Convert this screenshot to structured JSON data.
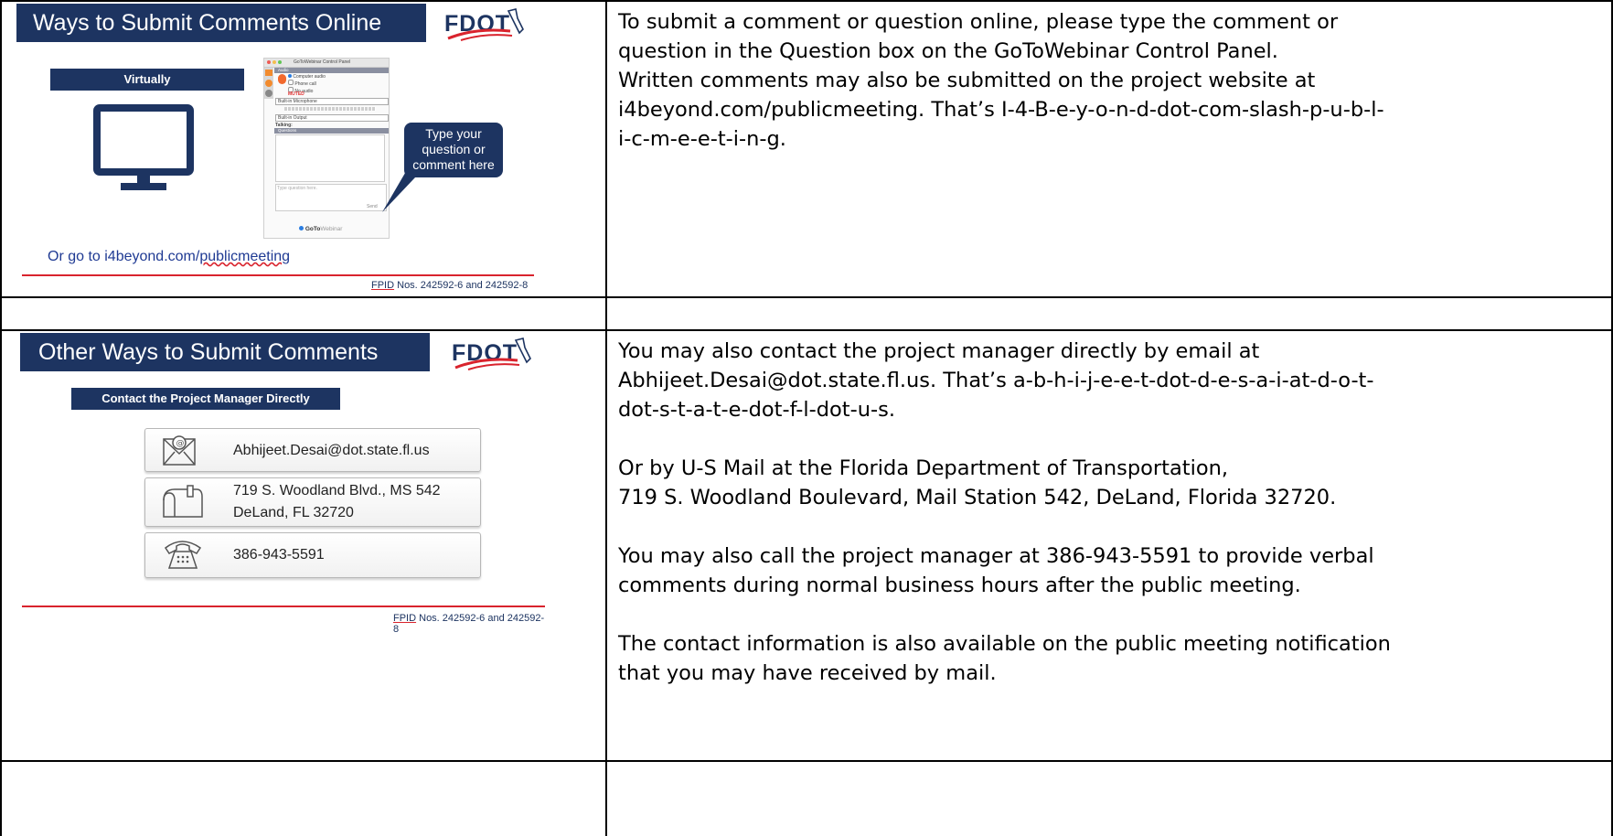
{
  "slide1": {
    "title": "Ways to Submit Comments Online",
    "logo": "FDOT",
    "virtually_label": "Virtually",
    "panel": {
      "title": "GoToWebinar Control Panel",
      "audio_header": "Audio",
      "computer_audio": "Computer audio",
      "phone_call": "Phone call",
      "no_audio": "No audio",
      "muted": "MUTED",
      "microphone": "Built-in Microphone",
      "output": "Built-in Output",
      "talking": "Talking:",
      "questions_header": "Questions",
      "question_placeholder": "Type question here.",
      "send": "Send",
      "brand_bold": "GoTo",
      "brand_light": "Webinar"
    },
    "callout": "Type your question or comment here",
    "link_prefix": "Or go to i4beyond.com/",
    "link_suffix": "publicmeeting",
    "fpid_prefix": "FPID",
    "fpid_rest": " Nos. 242592-6 and 242592-8"
  },
  "slide2": {
    "title": "Other Ways to Submit Comments",
    "logo": "FDOT",
    "contact_label": "Contact the Project Manager Directly",
    "email": "Abhijeet.Desai@dot.state.fl.us",
    "address_line1": "719 S. Woodland Blvd., MS 542",
    "address_line2": "DeLand, FL  32720",
    "phone": "386-943-5591",
    "fpid_prefix": "FPID",
    "fpid_rest": " Nos. 242592-6 and 242592-8"
  },
  "narration1": {
    "line1": "To submit a comment or question online, please type the comment or",
    "line2": "question in the Question box on the GoToWebinar Control Panel.",
    "line3": "Written comments may also be submitted on the project website at",
    "line4": "i4beyond.com/publicmeeting. That’s I-4-B-e-y-o-n-d-dot-com-slash-p-u-b-l-",
    "line5": "i-c-m-e-e-t-i-n-g."
  },
  "narration2": {
    "p1_line1": "You may also contact the project manager directly by email at",
    "p1_line2": "Abhijeet.Desai@dot.state.fl.us. That’s a-b-h-i-j-e-e-t-dot-d-e-s-a-i-at-d-o-t-",
    "p1_line3": "dot-s-t-a-t-e-dot-f-l-dot-u-s.",
    "p2_line1": "Or by U-S Mail at the Florida Department of Transportation,",
    "p2_line2": "719 S. Woodland Boulevard, Mail Station 542, DeLand, Florida 32720.",
    "p3_line1": "You may also call the project manager at 386-943-5591 to provide verbal",
    "p3_line2": "comments during normal business hours after the public meeting.",
    "p4_line1": "The contact information is also available on the public meeting notification",
    "p4_line2": "that you may have received by mail."
  },
  "colors": {
    "navy": "#1d3461",
    "red": "#d9232d",
    "link": "#1f3a93"
  }
}
